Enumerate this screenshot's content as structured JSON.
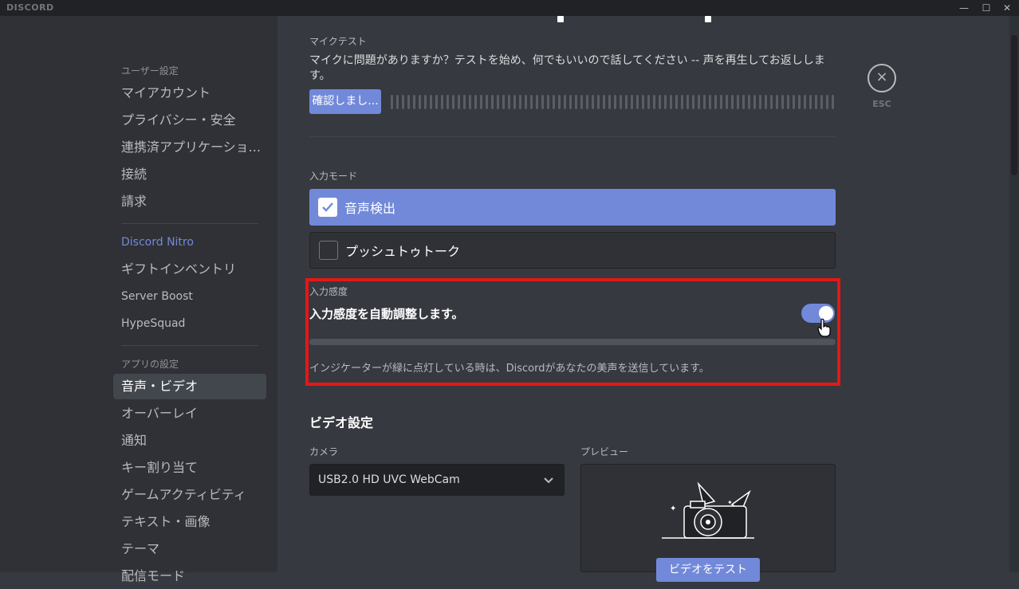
{
  "titlebar": {
    "brand": "DISCORD",
    "minimize": "—",
    "maximize": "☐",
    "close": "✕"
  },
  "sidebar": {
    "user_settings_header": "ユーザー設定",
    "user_items": [
      "マイアカウント",
      "プライバシー・安全",
      "連携済アプリケーショ...",
      "接続",
      "請求"
    ],
    "nitro": "Discord Nitro",
    "nitro_items": [
      "ギフトインベントリ",
      "Server Boost",
      "HypeSquad"
    ],
    "app_settings_header": "アプリの設定",
    "app_items": [
      "音声・ビデオ",
      "オーバーレイ",
      "通知",
      "キー割り当て",
      "ゲームアクティビティ",
      "テキスト・画像",
      "テーマ",
      "配信モード"
    ],
    "active_item": "音声・ビデオ"
  },
  "mic_test": {
    "title": "マイクテスト",
    "description_line1": "マイクに問題がありますか？テストを始め、何でもいいので話してください -- 声を再生してお返ししま",
    "description_line2": "す。",
    "button": "確認しまし..."
  },
  "input_mode": {
    "title": "入力モード",
    "options": [
      "音声検出",
      "プッシュトゥトーク"
    ],
    "selected": "音声検出"
  },
  "input_sensitivity": {
    "title": "入力感度",
    "auto_label": "入力感度を自動調整します。",
    "auto_enabled": true,
    "hint": "インジケーターが緑に点灯している時は、Discordがあなたの美声を送信しています。"
  },
  "video_settings": {
    "title": "ビデオ設定",
    "camera_label": "カメラ",
    "camera_value": "USB2.0 HD UVC WebCam",
    "preview_label": "プレビュー",
    "test_button": "ビデオをテスト"
  },
  "esc": {
    "label": "ESC",
    "icon": "×"
  },
  "colors": {
    "accent": "#7289da",
    "highlight": "#e51717",
    "background": "#36393f",
    "sidebar": "#2f3136"
  }
}
